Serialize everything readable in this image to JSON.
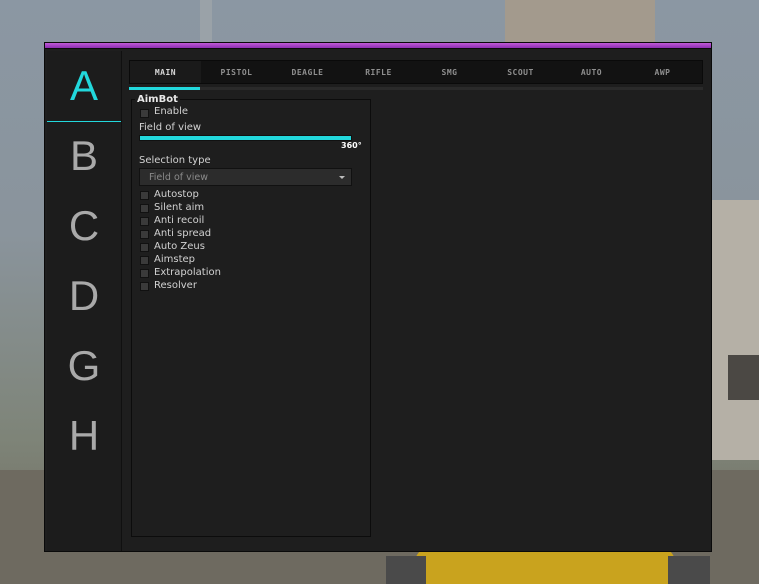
{
  "sidebar": {
    "items": [
      {
        "letter": "A",
        "active": true
      },
      {
        "letter": "B",
        "active": false
      },
      {
        "letter": "C",
        "active": false
      },
      {
        "letter": "D",
        "active": false
      },
      {
        "letter": "G",
        "active": false
      },
      {
        "letter": "H",
        "active": false
      }
    ]
  },
  "tabs": [
    {
      "label": "MAIN",
      "active": true
    },
    {
      "label": "PISTOL",
      "active": false
    },
    {
      "label": "DEAGLE",
      "active": false
    },
    {
      "label": "RIFLE",
      "active": false
    },
    {
      "label": "SMG",
      "active": false
    },
    {
      "label": "SCOUT",
      "active": false
    },
    {
      "label": "AUTO",
      "active": false
    },
    {
      "label": "AWP",
      "active": false
    }
  ],
  "aimbot": {
    "title": "AimBot",
    "enable_label": "Enable",
    "enable_checked": false,
    "fov": {
      "label": "Field of view",
      "value_text": "360°",
      "value": 360,
      "max": 360
    },
    "selection": {
      "label": "Selection type",
      "value": "Field of view"
    },
    "options": [
      {
        "label": "Autostop",
        "checked": false
      },
      {
        "label": "Silent aim",
        "checked": false
      },
      {
        "label": "Anti recoil",
        "checked": false
      },
      {
        "label": "Anti spread",
        "checked": false
      },
      {
        "label": "Auto Zeus",
        "checked": false
      },
      {
        "label": "Aimstep",
        "checked": false
      },
      {
        "label": "Extrapolation",
        "checked": false
      },
      {
        "label": "Resolver",
        "checked": false
      }
    ]
  },
  "colors": {
    "accent": "#22d8dc",
    "topbar": "#a040c4",
    "panel": "#1e1e1e"
  }
}
